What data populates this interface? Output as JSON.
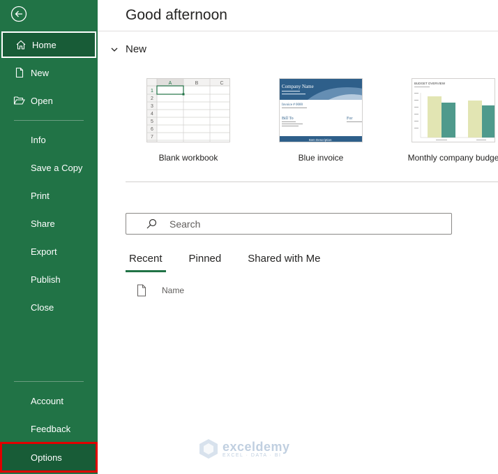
{
  "sidebar": {
    "back_label": "Back",
    "items": [
      {
        "label": "Home",
        "icon": "home-icon"
      },
      {
        "label": "New",
        "icon": "new-document-icon"
      },
      {
        "label": "Open",
        "icon": "open-folder-icon"
      },
      {
        "label": "Info"
      },
      {
        "label": "Save a Copy"
      },
      {
        "label": "Print"
      },
      {
        "label": "Share"
      },
      {
        "label": "Export"
      },
      {
        "label": "Publish"
      },
      {
        "label": "Close"
      },
      {
        "label": "Account"
      },
      {
        "label": "Feedback"
      },
      {
        "label": "Options"
      }
    ],
    "accent": "#217346",
    "active_bg": "#185c37",
    "highlight_color": "#e00000"
  },
  "main": {
    "greeting": "Good afternoon",
    "new_section": {
      "title": "New",
      "templates": [
        {
          "label": "Blank workbook",
          "thumb": {
            "col_a": "A",
            "col_b": "B",
            "col_c": "C",
            "rows": [
              "1",
              "2",
              "3",
              "4",
              "5",
              "6",
              "7"
            ]
          }
        },
        {
          "label": "Blue invoice",
          "thumb": {
            "company": "Company Name",
            "invoice": "Invoice # 0000",
            "bill_to": "Bill To",
            "for": "For",
            "item_description": "Item Description"
          }
        },
        {
          "label": "Monthly company budge",
          "thumb": {
            "title": "BUDGET OVERVIEW"
          }
        }
      ]
    },
    "search": {
      "placeholder": "Search"
    },
    "tabs": [
      {
        "label": "Recent",
        "active": true
      },
      {
        "label": "Pinned",
        "active": false
      },
      {
        "label": "Shared with Me",
        "active": false
      }
    ],
    "file_list": {
      "name_header": "Name"
    }
  },
  "watermark": {
    "name": "exceldemy",
    "sub": "EXCEL · DATA · BI"
  }
}
